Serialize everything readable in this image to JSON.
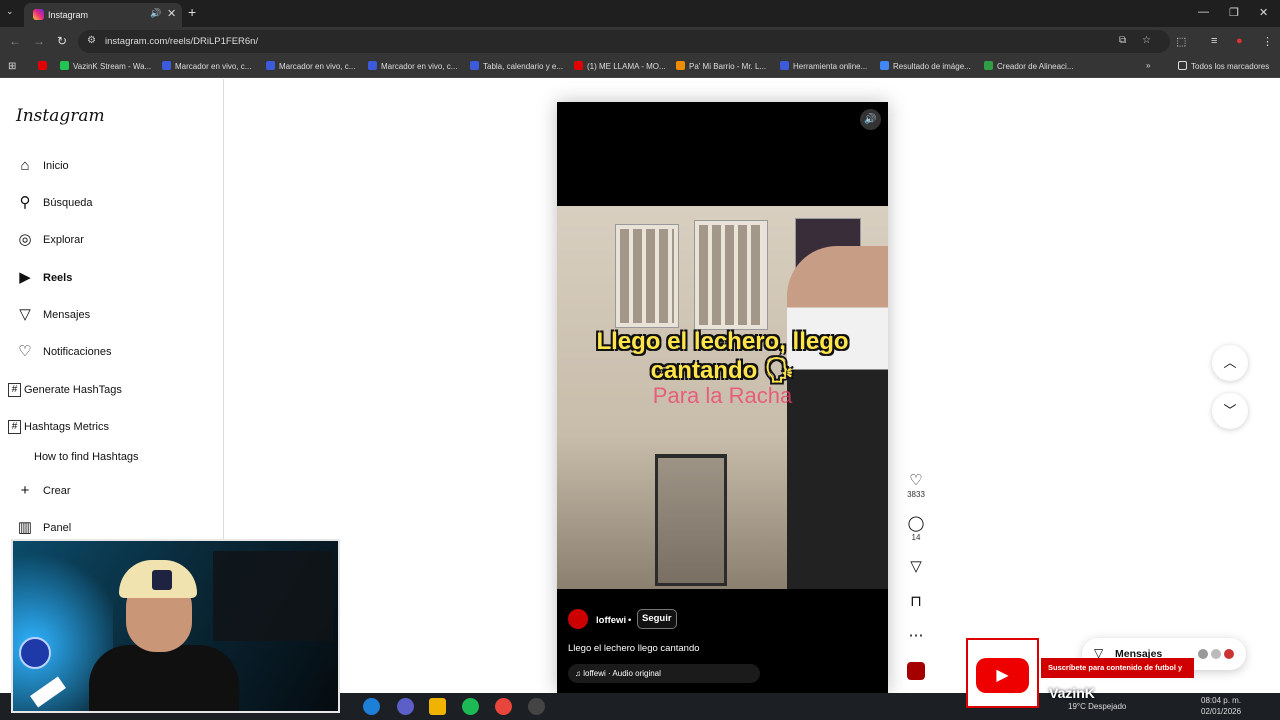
{
  "browser": {
    "tab_title": "Instagram",
    "url": "instagram.com/reels/DRiLP1FER6n/",
    "bookmarks": [
      {
        "label": "",
        "color": "#e00000"
      },
      {
        "label": "VazinK Stream - Wa...",
        "color": "#23c552"
      },
      {
        "label": "Marcador en vivo, c...",
        "color": "#3b5bdb"
      },
      {
        "label": "Marcador en vivo, c...",
        "color": "#3b5bdb"
      },
      {
        "label": "Marcador en vivo, c...",
        "color": "#3b5bdb"
      },
      {
        "label": "Tabla, calendario y e...",
        "color": "#3b5bdb"
      },
      {
        "label": "(1) ME LLAMA - MO...",
        "color": "#e00000"
      },
      {
        "label": "Pa' Mi Barrio - Mr. L...",
        "color": "#f08c00"
      },
      {
        "label": "Herramienta online...",
        "color": "#3b5bdb"
      },
      {
        "label": "Resultado de imáge...",
        "color": "#4285f4"
      },
      {
        "label": "Creador de Alineaci...",
        "color": "#2f9e44"
      }
    ],
    "all_bookmarks": "Todos los marcadores"
  },
  "sidebar": {
    "logo": "Instagram",
    "items": [
      {
        "label": "Inicio",
        "icon": "home-icon"
      },
      {
        "label": "Búsqueda",
        "icon": "search-icon"
      },
      {
        "label": "Explorar",
        "icon": "compass-icon"
      },
      {
        "label": "Reels",
        "icon": "reels-icon"
      },
      {
        "label": "Mensajes",
        "icon": "send-icon"
      },
      {
        "label": "Notificaciones",
        "icon": "heart-icon"
      },
      {
        "label": "Generate HashTags",
        "icon": "hashtag-icon"
      },
      {
        "label": "Hashtags Metrics",
        "icon": "hashtag-icon"
      }
    ],
    "how_to": "How to find Hashtags",
    "crear": "Crear",
    "panel": "Panel"
  },
  "reel": {
    "caption_overlay_line1": "Llego el lechero, llego",
    "caption_overlay_line2": "cantando 🗣",
    "caption_overlay_sub": "Para la Racha",
    "username": "loffewi",
    "follow_label": "Seguir",
    "caption": "Llego el lechero llego cantando",
    "audio": "loffewi · Audio original",
    "likes": "3833",
    "comments": "14"
  },
  "messages_label": "Mensajes",
  "overlay": {
    "subscribe_text": "Suscríbete para contenido de futbol y mas!",
    "channel_name": "VazinK"
  },
  "taskbar": {
    "weather": "19°C  Despejado",
    "time": "08:04 p. m.",
    "date": "02/01/2026"
  }
}
